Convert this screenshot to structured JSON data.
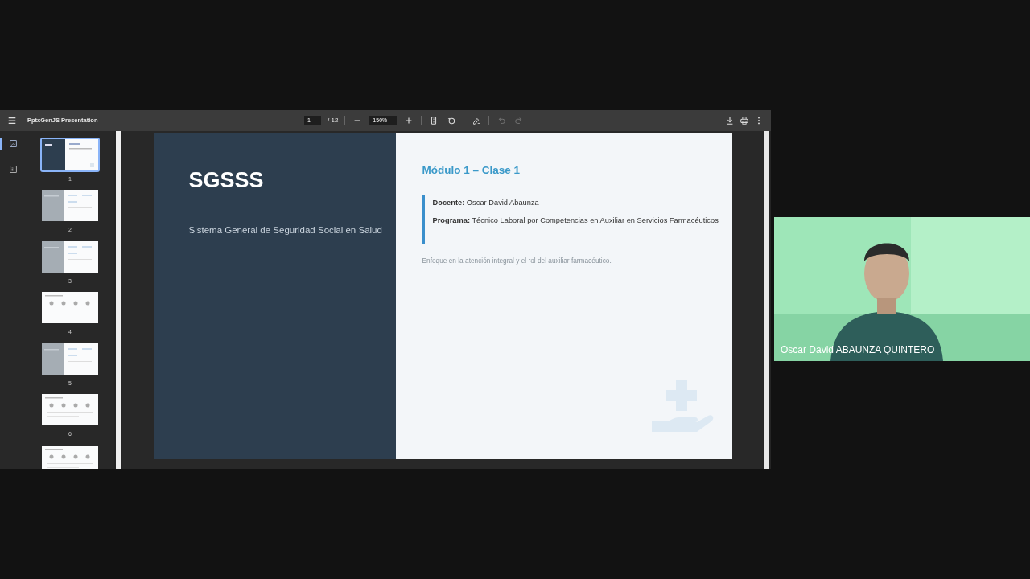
{
  "viewer": {
    "title": "PptxGenJS Presentation",
    "page": "1",
    "page_total": "/ 12",
    "zoom": "150%",
    "undo": {
      "disabled": true
    },
    "redo": {
      "disabled": true
    },
    "sidebar_tabs": [
      {
        "kind": "thumbnails",
        "selected": true
      },
      {
        "kind": "outline",
        "selected": false
      }
    ],
    "thumbnails": [
      {
        "kind": "split-dark",
        "label": "1",
        "selected": true
      },
      {
        "kind": "split-grey",
        "label": "2",
        "selected": false
      },
      {
        "kind": "split-grey",
        "label": "3",
        "selected": false
      },
      {
        "kind": "plain",
        "label": "4",
        "selected": false
      },
      {
        "kind": "split-grey",
        "label": "5",
        "selected": false
      },
      {
        "kind": "plain",
        "label": "6",
        "selected": false
      },
      {
        "kind": "plain",
        "selected": false
      }
    ]
  },
  "slide": {
    "title": "SGSSS",
    "subtitle": "Sistema General de Seguridad Social en Salud",
    "heading": "Módulo 1 – Clase 1",
    "details": [
      "**Docente:** Oscar David Abaunza",
      "**Programa:** Técnico Laboral por Competencias en Auxiliar en Servicios Farmacéuticos"
    ],
    "note": "Enfoque en la atención integral y el rol del auxiliar farmacéutico."
  },
  "video": {
    "name": "Oscar David ABAUNZA QUINTERO"
  }
}
